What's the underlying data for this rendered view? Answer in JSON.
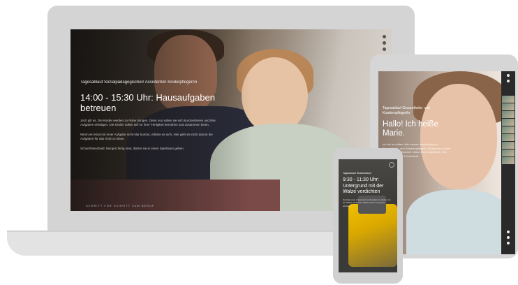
{
  "laptop": {
    "subtitle": "Tagesablauf Sozialpädagogische/r Assistent/in Kinderpfleger/in",
    "title": "14:00 - 15:30 Uhr: Hausaufgaben betreuen",
    "paragraph_1": "Jetzt gilt es. Die Kinder werden zu Ruhe bringen. Denn nun sollen sie sich konzentrieren und ihre Aufgaben erledigen. Die Kinder sollen sich in ihrer Fertigkeit bemühen und zusammen lösen.",
    "paragraph_2": "Wenn ein Kind mit einer Aufgabe nicht klar kommt, erkläre es sich. Hier geht es nicht darum die Aufgaben für das Kind zu lösen.",
    "paragraph_3": "Schnell Bescheid: Morgen fertig sind, dürfen sie in einen Spielraum gehen.",
    "footer": "SCHRITT FÜR SCHRITT ZUM BERUF"
  },
  "tablet": {
    "subtitle": "Tagesablauf Gesundheits- und Krankenpfleger/in",
    "title": "Hallo! Ich heiße Marie.",
    "paragraph": "Ich bin im dritten Jahr meiner Ausbildung zur Gesundheits- und Krankenpflegerin. Momentan arbeite ich in der Notaufnahme eines Universitätsklinik. Hier erlebe ich meine Frühschicht."
  },
  "phone": {
    "subtitle": "Tagesablauf Straßenbauer",
    "title": "9:30 - 11:30 Uhr: Untergrund mit der Walze verdichten",
    "paragraph": "Nachdem der Untergrund vorbereitet ist, wird er mit der Walze verdichtet. Dabei muss man genau arbeiten."
  }
}
